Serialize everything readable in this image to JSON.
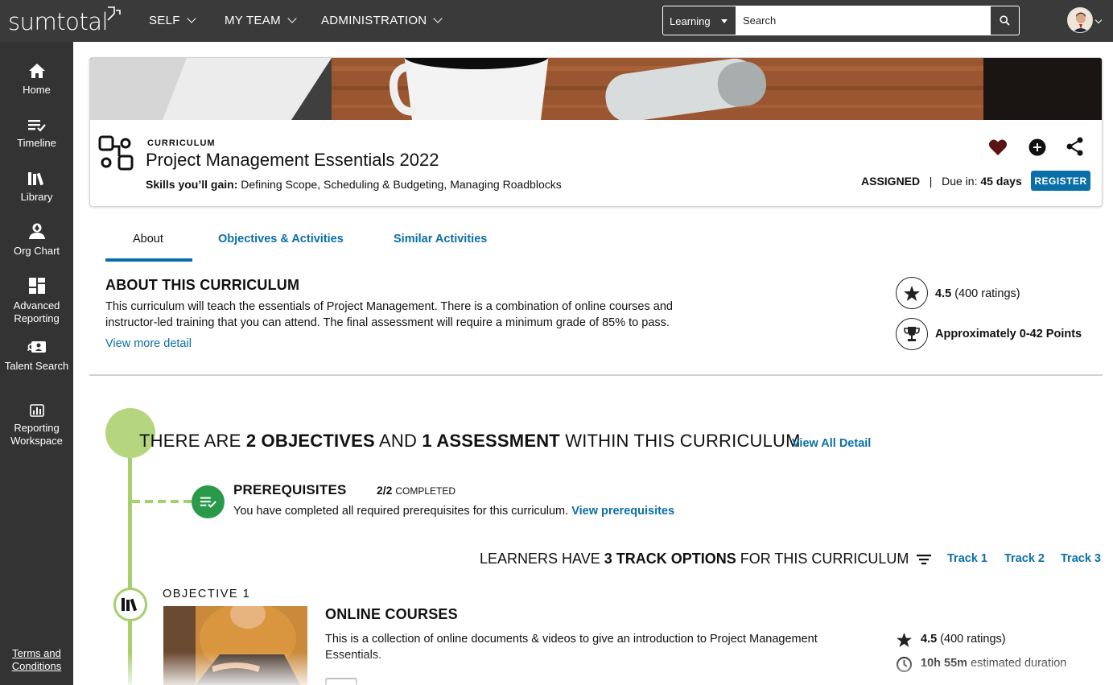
{
  "topbar": {
    "logo": "sumtotal",
    "nav": [
      {
        "label": "SELF"
      },
      {
        "label": "MY TEAM"
      },
      {
        "label": "ADMINISTRATION"
      }
    ],
    "search": {
      "scope": "Learning",
      "placeholder": "Search"
    }
  },
  "sidenav": {
    "items": [
      {
        "label": "Home",
        "icon": "home-icon"
      },
      {
        "label": "Timeline",
        "icon": "timeline-icon"
      },
      {
        "label": "Library",
        "icon": "library-icon"
      },
      {
        "label": "Org Chart",
        "icon": "org-chart-icon"
      },
      {
        "label": "Advanced Reporting",
        "icon": "dashboard-icon"
      },
      {
        "label": "Talent Search",
        "icon": "talent-search-icon"
      },
      {
        "label": "Reporting Workspace",
        "icon": "reporting-icon"
      }
    ],
    "terms": "Terms and Conditions"
  },
  "curriculum": {
    "eyebrow": "CURRICULUM",
    "title": "Project Management Essentials 2022",
    "skills_label": "Skills you’ll gain:",
    "skills": "Defining Scope, Scheduling & Budgeting, Managing Roadblocks",
    "status": "ASSIGNED",
    "due_label": "Due in:",
    "due_value": "45 days",
    "register_label": "REGISTER"
  },
  "tabs": [
    {
      "label": "About"
    },
    {
      "label": "Objectives & Activities"
    },
    {
      "label": "Similar Activities"
    }
  ],
  "about": {
    "heading": "ABOUT THIS CURRICULUM",
    "description": "This curriculum will teach the essentials of Project Management. There is a combination of online courses and instructor-led training that you can attend. The final assessment will require a minimum grade of 85% to pass.",
    "view_more": "View more detail",
    "rating": "4.5",
    "rating_count": "(400 ratings)",
    "points": "Approximately 0-42 Points"
  },
  "structure": {
    "heading_pre": "THERE ARE ",
    "objectives": "2 OBJECTIVES",
    "heading_mid": " AND ",
    "assessments": "1 ASSESSMENT",
    "heading_post": " WITHIN THIS CURRICULUM",
    "view_all": "View All Detail"
  },
  "prerequisites": {
    "heading": "PREREQUISITES",
    "count": "2/2",
    "count_label": "COMPLETED",
    "text": "You have completed all required prerequisites for this curriculum.",
    "link": "View prerequisites"
  },
  "tracks": {
    "heading_pre": "LEARNERS HAVE ",
    "count": "3 TRACK OPTIONS",
    "heading_post": " FOR THIS CURRICULUM",
    "options": [
      "Track 1",
      "Track 2",
      "Track 3"
    ]
  },
  "objective1": {
    "label": "OBJECTIVE 1",
    "heading": "ONLINE COURSES",
    "description": "This is a collection of online documents & videos to give an introduction to Project Management Essentials.",
    "rating": "4.5",
    "rating_count": "(400 ratings)",
    "duration": "10h 55m",
    "duration_label": "estimated duration"
  },
  "colors": {
    "topbar": "#3a3a3a",
    "sidenav": "#333333",
    "link": "#0a6fa8",
    "timeline": "#a6cf6e",
    "prereq": "#2a9a4a",
    "favorite": "#5a1414"
  }
}
